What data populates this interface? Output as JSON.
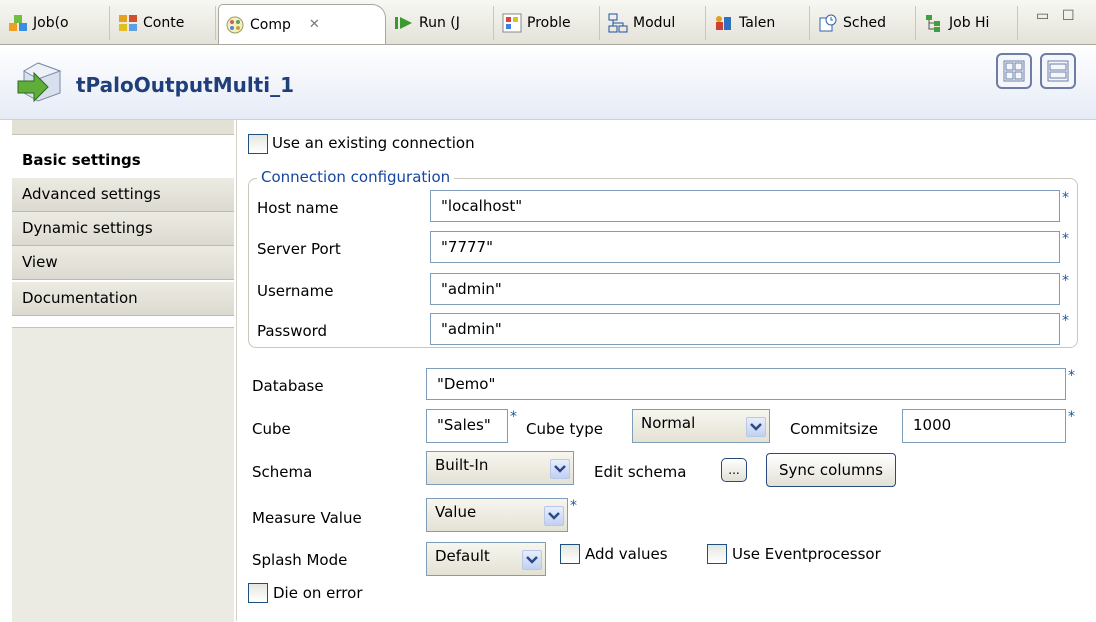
{
  "tabs": [
    {
      "label": "Job(o",
      "icon": "job-icon",
      "active": false
    },
    {
      "label": "Conte",
      "icon": "context-icon",
      "active": false
    },
    {
      "label": "Comp",
      "icon": "component-icon",
      "active": true
    },
    {
      "label": "Run (J",
      "icon": "run-icon",
      "active": false
    },
    {
      "label": "Proble",
      "icon": "problems-icon",
      "active": false
    },
    {
      "label": "Modul",
      "icon": "modules-icon",
      "active": false
    },
    {
      "label": "Talen",
      "icon": "talend-icon",
      "active": false
    },
    {
      "label": "Sched",
      "icon": "scheduler-icon",
      "active": false
    },
    {
      "label": "Job Hi",
      "icon": "job-hierarchy-icon",
      "active": false
    }
  ],
  "header": {
    "title": "tPaloOutputMulti_1",
    "icon": "palo-output-component-icon"
  },
  "nav": {
    "items": [
      {
        "label": "Basic settings"
      },
      {
        "label": "Advanced settings"
      },
      {
        "label": "Dynamic settings"
      },
      {
        "label": "View"
      },
      {
        "label": "Documentation"
      }
    ]
  },
  "form": {
    "use_existing_connection": "Use an existing connection",
    "connection_group": "Connection configuration",
    "host_label": "Host name",
    "host_value": "\"localhost\"",
    "port_label": "Server Port",
    "port_value": "\"7777\"",
    "user_label": "Username",
    "user_value": "\"admin\"",
    "password_label": "Password",
    "password_value": "\"admin\"",
    "database_label": "Database",
    "database_value": "\"Demo\"",
    "cube_label": "Cube",
    "cube_value": "\"Sales\"",
    "cube_type_label": "Cube type",
    "cube_type_value": "Normal",
    "commitsize_label": "Commitsize",
    "commitsize_value": "1000",
    "schema_label": "Schema",
    "schema_value": "Built-In",
    "edit_schema_label": "Edit schema",
    "edit_schema_button": "...",
    "sync_columns": "Sync columns",
    "measure_label": "Measure Value",
    "measure_value": "Value",
    "splash_label": "Splash Mode",
    "splash_value": "Default",
    "add_values": "Add values",
    "use_eventprocessor": "Use Eventprocessor",
    "die_on_error": "Die on error",
    "required_mark": "*"
  },
  "colors": {
    "title": "#1f3e7a",
    "group_legend": "#1646a0",
    "required": "#1b58a8"
  }
}
